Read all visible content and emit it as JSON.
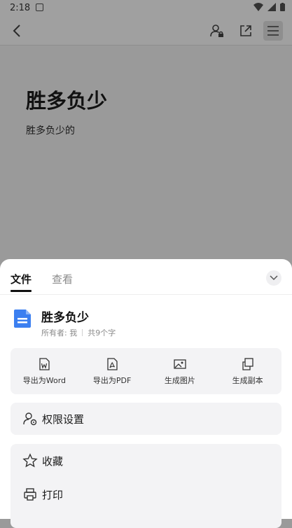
{
  "status_bar": {
    "time": "2:18"
  },
  "document": {
    "title": "胜多负少",
    "body": "胜多负少的"
  },
  "sheet": {
    "tabs": [
      {
        "label": "文件"
      },
      {
        "label": "查看"
      }
    ],
    "file": {
      "name": "胜多负少",
      "owner": "所有者: 我",
      "word_count": "共9个字"
    },
    "actions": [
      {
        "label": "导出为Word",
        "icon": "export-word-icon"
      },
      {
        "label": "导出为PDF",
        "icon": "export-pdf-icon"
      },
      {
        "label": "生成图片",
        "icon": "image-icon"
      },
      {
        "label": "生成副本",
        "icon": "copy-icon"
      }
    ],
    "permission": {
      "label": "权限设置"
    },
    "more": [
      {
        "label": "收藏"
      },
      {
        "label": "打印"
      }
    ]
  },
  "colors": {
    "accent": "#3b7ff0",
    "overlay": "#9a9a9a",
    "card": "#f3f3f5"
  }
}
